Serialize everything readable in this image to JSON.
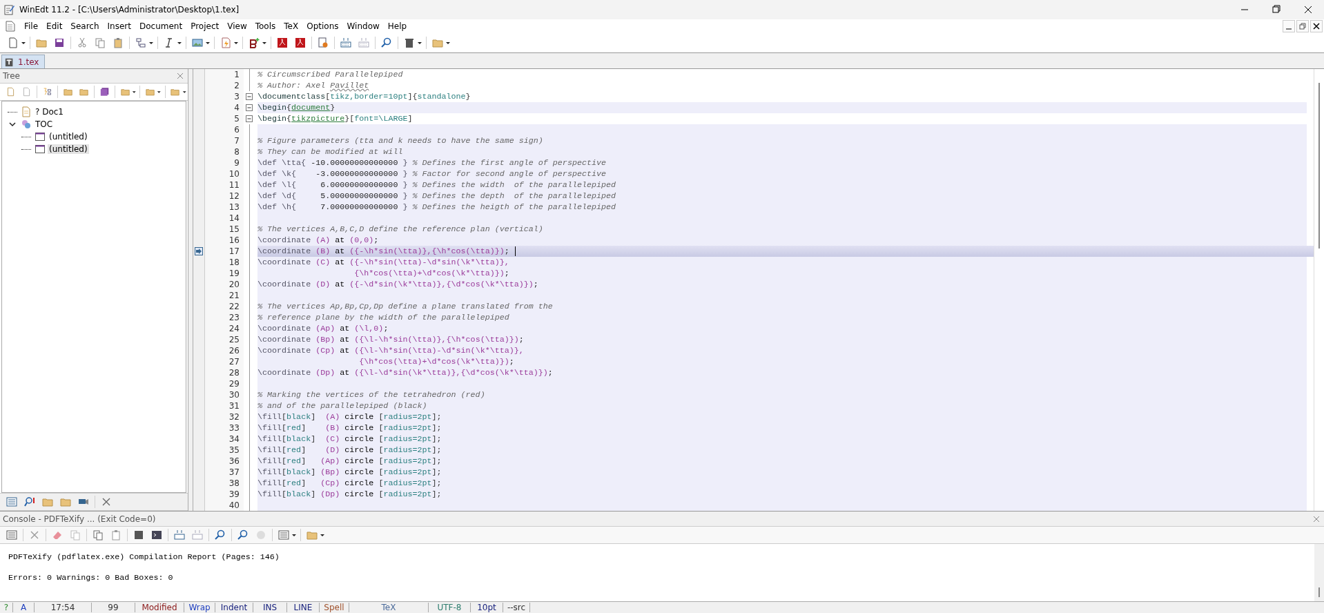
{
  "window": {
    "title": "WinEdt 11.2 - [C:\\Users\\Administrator\\Desktop\\1.tex]"
  },
  "menu": [
    "File",
    "Edit",
    "Search",
    "Insert",
    "Document",
    "Project",
    "View",
    "Tools",
    "TeX",
    "Options",
    "Window",
    "Help"
  ],
  "tabs": [
    {
      "label": "1.tex",
      "selected": true
    }
  ],
  "tree": {
    "title": "Tree",
    "items": [
      {
        "label": "? Doc1",
        "kind": "document",
        "selected": false
      },
      {
        "label": "TOC",
        "kind": "toc",
        "selected": false,
        "expanded": true,
        "children": [
          {
            "label": "(untitled)",
            "kind": "section",
            "selected": false
          },
          {
            "label": "(untitled)",
            "kind": "section",
            "selected": true
          }
        ]
      }
    ]
  },
  "editor": {
    "lines": [
      {
        "n": "1",
        "block": false,
        "current": false,
        "fold": false,
        "bookmark": false,
        "segs": [
          {
            "kind": "comment",
            "text": "% Circumscribed Parallelepiped"
          }
        ]
      },
      {
        "n": "2",
        "block": false,
        "current": false,
        "fold": false,
        "bookmark": false,
        "segs": [
          {
            "kind": "comment",
            "text": "% Author: Axel "
          },
          {
            "kind": "misspelled",
            "text": "Pavillet"
          }
        ]
      },
      {
        "n": "3",
        "block": false,
        "current": false,
        "fold": true,
        "bookmark": false,
        "segs": [
          {
            "kind": "cmd",
            "text": "\\documentclass"
          },
          {
            "kind": "br",
            "text": "["
          },
          {
            "kind": "opt",
            "text": "tikz,border=10pt"
          },
          {
            "kind": "br",
            "text": "]{"
          },
          {
            "kind": "opt",
            "text": "standalone"
          },
          {
            "kind": "br",
            "text": "}"
          }
        ]
      },
      {
        "n": "4",
        "block": true,
        "current": false,
        "fold": true,
        "bookmark": false,
        "segs": [
          {
            "kind": "cmd",
            "text": "\\begin"
          },
          {
            "kind": "br",
            "text": "{"
          },
          {
            "kind": "env",
            "text": "document"
          },
          {
            "kind": "br",
            "text": "}"
          }
        ]
      },
      {
        "n": "5",
        "block": false,
        "current": false,
        "fold": true,
        "bookmark": false,
        "segs": [
          {
            "kind": "cmd",
            "text": "\\begin"
          },
          {
            "kind": "br",
            "text": "{"
          },
          {
            "kind": "env",
            "text": "tikzpicture"
          },
          {
            "kind": "br",
            "text": "}["
          },
          {
            "kind": "opt",
            "text": "font=\\LARGE"
          },
          {
            "kind": "br",
            "text": "]"
          }
        ]
      },
      {
        "n": "6",
        "block": true,
        "current": false,
        "fold": false,
        "bookmark": false
      },
      {
        "n": "7",
        "block": true,
        "current": false,
        "fold": false,
        "bookmark": false,
        "segs": [
          {
            "kind": "comment",
            "text": "% Figure parameters (tta and k needs to have the same sign)"
          }
        ]
      },
      {
        "n": "8",
        "block": true,
        "current": false,
        "fold": false,
        "bookmark": false,
        "segs": [
          {
            "kind": "comment",
            "text": "% They can be modified at will"
          }
        ]
      },
      {
        "n": "9",
        "block": true,
        "current": false,
        "fold": false,
        "bookmark": false,
        "segs": [
          {
            "kind": "macro",
            "text": "\\def \\tta{"
          },
          {
            "kind": "plain",
            "text": " -10.00000000000000 "
          },
          {
            "kind": "macro",
            "text": "}"
          },
          {
            "kind": "comment",
            "text": " % Defines the first angle of perspective"
          }
        ]
      },
      {
        "n": "10",
        "block": true,
        "current": false,
        "fold": false,
        "bookmark": false,
        "segs": [
          {
            "kind": "macro",
            "text": "\\def \\k{"
          },
          {
            "kind": "plain",
            "text": "    -3.00000000000000 "
          },
          {
            "kind": "macro",
            "text": "}"
          },
          {
            "kind": "comment",
            "text": " % Factor for second angle of perspective"
          }
        ]
      },
      {
        "n": "11",
        "block": true,
        "current": false,
        "fold": false,
        "bookmark": false,
        "segs": [
          {
            "kind": "macro",
            "text": "\\def \\l{"
          },
          {
            "kind": "plain",
            "text": "     6.00000000000000 "
          },
          {
            "kind": "macro",
            "text": "}"
          },
          {
            "kind": "comment",
            "text": " % Defines the width  of the parallelepiped"
          }
        ]
      },
      {
        "n": "12",
        "block": true,
        "current": false,
        "fold": false,
        "bookmark": false,
        "segs": [
          {
            "kind": "macro",
            "text": "\\def \\d{"
          },
          {
            "kind": "plain",
            "text": "     5.00000000000000 "
          },
          {
            "kind": "macro",
            "text": "}"
          },
          {
            "kind": "comment",
            "text": " % Defines the depth  of the parallelepiped"
          }
        ]
      },
      {
        "n": "13",
        "block": true,
        "current": false,
        "fold": false,
        "bookmark": false,
        "segs": [
          {
            "kind": "macro",
            "text": "\\def \\h{"
          },
          {
            "kind": "plain",
            "text": "     7.00000000000000 "
          },
          {
            "kind": "macro",
            "text": "}"
          },
          {
            "kind": "comment",
            "text": " % Defines the heigth of the parallelepiped"
          }
        ]
      },
      {
        "n": "14",
        "block": true,
        "current": false,
        "fold": false,
        "bookmark": false
      },
      {
        "n": "15",
        "block": true,
        "current": false,
        "fold": false,
        "bookmark": false,
        "segs": [
          {
            "kind": "comment",
            "text": "% The vertices A,B,C,D define the reference plan (vertical)"
          }
        ]
      },
      {
        "n": "16",
        "block": true,
        "current": false,
        "fold": false,
        "bookmark": false,
        "segs": [
          {
            "kind": "macro",
            "text": "\\coordinate "
          },
          {
            "kind": "math",
            "text": "(A) "
          },
          {
            "kind": "kw",
            "text": "at "
          },
          {
            "kind": "math",
            "text": "(0,0)"
          },
          {
            "kind": "plain",
            "text": ";"
          }
        ]
      },
      {
        "n": "17",
        "block": true,
        "current": true,
        "fold": false,
        "bookmark": true,
        "segs": [
          {
            "kind": "macro",
            "text": "\\coordinate "
          },
          {
            "kind": "math",
            "text": "(B) "
          },
          {
            "kind": "kw",
            "text": "at "
          },
          {
            "kind": "math",
            "text": "({-\\h*sin(\\tta)},{\\h*cos(\\tta)})"
          },
          {
            "kind": "plain",
            "text": ";"
          }
        ]
      },
      {
        "n": "18",
        "block": true,
        "current": false,
        "fold": false,
        "bookmark": false,
        "segs": [
          {
            "kind": "macro",
            "text": "\\coordinate "
          },
          {
            "kind": "math",
            "text": "(C) "
          },
          {
            "kind": "kw",
            "text": "at "
          },
          {
            "kind": "math",
            "text": "({-\\h*sin(\\tta)-\\d*sin(\\k*\\tta)},"
          }
        ]
      },
      {
        "n": "19",
        "block": true,
        "current": false,
        "fold": false,
        "bookmark": false,
        "segs": [
          {
            "kind": "math",
            "text": "                    {\\h*cos(\\tta)+\\d*cos(\\k*\\tta)})"
          },
          {
            "kind": "plain",
            "text": ";"
          }
        ]
      },
      {
        "n": "20",
        "block": true,
        "current": false,
        "fold": false,
        "bookmark": false,
        "segs": [
          {
            "kind": "macro",
            "text": "\\coordinate "
          },
          {
            "kind": "math",
            "text": "(D) "
          },
          {
            "kind": "kw",
            "text": "at "
          },
          {
            "kind": "math",
            "text": "({-\\d*sin(\\k*\\tta)},{\\d*cos(\\k*\\tta)})"
          },
          {
            "kind": "plain",
            "text": ";"
          }
        ]
      },
      {
        "n": "21",
        "block": true,
        "current": false,
        "fold": false,
        "bookmark": false
      },
      {
        "n": "22",
        "block": true,
        "current": false,
        "fold": false,
        "bookmark": false,
        "segs": [
          {
            "kind": "comment",
            "text": "% The vertices Ap,Bp,Cp,Dp define a plane translated from the"
          }
        ]
      },
      {
        "n": "23",
        "block": true,
        "current": false,
        "fold": false,
        "bookmark": false,
        "segs": [
          {
            "kind": "comment",
            "text": "% reference plane by the width of the parallelepiped"
          }
        ]
      },
      {
        "n": "24",
        "block": true,
        "current": false,
        "fold": false,
        "bookmark": false,
        "segs": [
          {
            "kind": "macro",
            "text": "\\coordinate "
          },
          {
            "kind": "math",
            "text": "(Ap) "
          },
          {
            "kind": "kw",
            "text": "at "
          },
          {
            "kind": "math",
            "text": "(\\l,0)"
          },
          {
            "kind": "plain",
            "text": ";"
          }
        ]
      },
      {
        "n": "25",
        "block": true,
        "current": false,
        "fold": false,
        "bookmark": false,
        "segs": [
          {
            "kind": "macro",
            "text": "\\coordinate "
          },
          {
            "kind": "math",
            "text": "(Bp) "
          },
          {
            "kind": "kw",
            "text": "at "
          },
          {
            "kind": "math",
            "text": "({\\l-\\h*sin(\\tta)},{\\h*cos(\\tta)})"
          },
          {
            "kind": "plain",
            "text": ";"
          }
        ]
      },
      {
        "n": "26",
        "block": true,
        "current": false,
        "fold": false,
        "bookmark": false,
        "segs": [
          {
            "kind": "macro",
            "text": "\\coordinate "
          },
          {
            "kind": "math",
            "text": "(Cp) "
          },
          {
            "kind": "kw",
            "text": "at "
          },
          {
            "kind": "math",
            "text": "({\\l-\\h*sin(\\tta)-\\d*sin(\\k*\\tta)},"
          }
        ]
      },
      {
        "n": "27",
        "block": true,
        "current": false,
        "fold": false,
        "bookmark": false,
        "segs": [
          {
            "kind": "math",
            "text": "                     {\\h*cos(\\tta)+\\d*cos(\\k*\\tta)})"
          },
          {
            "kind": "plain",
            "text": ";"
          }
        ]
      },
      {
        "n": "28",
        "block": true,
        "current": false,
        "fold": false,
        "bookmark": false,
        "segs": [
          {
            "kind": "macro",
            "text": "\\coordinate "
          },
          {
            "kind": "math",
            "text": "(Dp) "
          },
          {
            "kind": "kw",
            "text": "at "
          },
          {
            "kind": "math",
            "text": "({\\l-\\d*sin(\\k*\\tta)},{\\d*cos(\\k*\\tta)})"
          },
          {
            "kind": "plain",
            "text": ";"
          }
        ]
      },
      {
        "n": "29",
        "block": true,
        "current": false,
        "fold": false,
        "bookmark": false
      },
      {
        "n": "30",
        "block": true,
        "current": false,
        "fold": false,
        "bookmark": false,
        "segs": [
          {
            "kind": "comment",
            "text": "% Marking the vertices of the tetrahedron (red)"
          }
        ]
      },
      {
        "n": "31",
        "block": true,
        "current": false,
        "fold": false,
        "bookmark": false,
        "segs": [
          {
            "kind": "comment",
            "text": "% and of the parallelepiped (black)"
          }
        ]
      },
      {
        "n": "32",
        "block": true,
        "current": false,
        "fold": false,
        "bookmark": false,
        "segs": [
          {
            "kind": "macro",
            "text": "\\fill"
          },
          {
            "kind": "br",
            "text": "["
          },
          {
            "kind": "opt",
            "text": "black"
          },
          {
            "kind": "br",
            "text": "]  "
          },
          {
            "kind": "math",
            "text": "(A) "
          },
          {
            "kind": "kw",
            "text": "circle "
          },
          {
            "kind": "br",
            "text": "["
          },
          {
            "kind": "opt",
            "text": "radius=2pt"
          },
          {
            "kind": "br",
            "text": "];"
          }
        ]
      },
      {
        "n": "33",
        "block": true,
        "current": false,
        "fold": false,
        "bookmark": false,
        "segs": [
          {
            "kind": "macro",
            "text": "\\fill"
          },
          {
            "kind": "br",
            "text": "["
          },
          {
            "kind": "opt",
            "text": "red"
          },
          {
            "kind": "br",
            "text": "]    "
          },
          {
            "kind": "math",
            "text": "(B) "
          },
          {
            "kind": "kw",
            "text": "circle "
          },
          {
            "kind": "br",
            "text": "["
          },
          {
            "kind": "opt",
            "text": "radius=2pt"
          },
          {
            "kind": "br",
            "text": "];"
          }
        ]
      },
      {
        "n": "34",
        "block": true,
        "current": false,
        "fold": false,
        "bookmark": false,
        "segs": [
          {
            "kind": "macro",
            "text": "\\fill"
          },
          {
            "kind": "br",
            "text": "["
          },
          {
            "kind": "opt",
            "text": "black"
          },
          {
            "kind": "br",
            "text": "]  "
          },
          {
            "kind": "math",
            "text": "(C) "
          },
          {
            "kind": "kw",
            "text": "circle "
          },
          {
            "kind": "br",
            "text": "["
          },
          {
            "kind": "opt",
            "text": "radius=2pt"
          },
          {
            "kind": "br",
            "text": "];"
          }
        ]
      },
      {
        "n": "35",
        "block": true,
        "current": false,
        "fold": false,
        "bookmark": false,
        "segs": [
          {
            "kind": "macro",
            "text": "\\fill"
          },
          {
            "kind": "br",
            "text": "["
          },
          {
            "kind": "opt",
            "text": "red"
          },
          {
            "kind": "br",
            "text": "]    "
          },
          {
            "kind": "math",
            "text": "(D) "
          },
          {
            "kind": "kw",
            "text": "circle "
          },
          {
            "kind": "br",
            "text": "["
          },
          {
            "kind": "opt",
            "text": "radius=2pt"
          },
          {
            "kind": "br",
            "text": "];"
          }
        ]
      },
      {
        "n": "36",
        "block": true,
        "current": false,
        "fold": false,
        "bookmark": false,
        "segs": [
          {
            "kind": "macro",
            "text": "\\fill"
          },
          {
            "kind": "br",
            "text": "["
          },
          {
            "kind": "opt",
            "text": "red"
          },
          {
            "kind": "br",
            "text": "]   "
          },
          {
            "kind": "math",
            "text": "(Ap) "
          },
          {
            "kind": "kw",
            "text": "circle "
          },
          {
            "kind": "br",
            "text": "["
          },
          {
            "kind": "opt",
            "text": "radius=2pt"
          },
          {
            "kind": "br",
            "text": "];"
          }
        ]
      },
      {
        "n": "37",
        "block": true,
        "current": false,
        "fold": false,
        "bookmark": false,
        "segs": [
          {
            "kind": "macro",
            "text": "\\fill"
          },
          {
            "kind": "br",
            "text": "["
          },
          {
            "kind": "opt",
            "text": "black"
          },
          {
            "kind": "br",
            "text": "] "
          },
          {
            "kind": "math",
            "text": "(Bp) "
          },
          {
            "kind": "kw",
            "text": "circle "
          },
          {
            "kind": "br",
            "text": "["
          },
          {
            "kind": "opt",
            "text": "radius=2pt"
          },
          {
            "kind": "br",
            "text": "];"
          }
        ]
      },
      {
        "n": "38",
        "block": true,
        "current": false,
        "fold": false,
        "bookmark": false,
        "segs": [
          {
            "kind": "macro",
            "text": "\\fill"
          },
          {
            "kind": "br",
            "text": "["
          },
          {
            "kind": "opt",
            "text": "red"
          },
          {
            "kind": "br",
            "text": "]   "
          },
          {
            "kind": "math",
            "text": "(Cp) "
          },
          {
            "kind": "kw",
            "text": "circle "
          },
          {
            "kind": "br",
            "text": "["
          },
          {
            "kind": "opt",
            "text": "radius=2pt"
          },
          {
            "kind": "br",
            "text": "];"
          }
        ]
      },
      {
        "n": "39",
        "block": true,
        "current": false,
        "fold": false,
        "bookmark": false,
        "segs": [
          {
            "kind": "macro",
            "text": "\\fill"
          },
          {
            "kind": "br",
            "text": "["
          },
          {
            "kind": "opt",
            "text": "black"
          },
          {
            "kind": "br",
            "text": "] "
          },
          {
            "kind": "math",
            "text": "(Dp) "
          },
          {
            "kind": "kw",
            "text": "circle "
          },
          {
            "kind": "br",
            "text": "["
          },
          {
            "kind": "opt",
            "text": "radius=2pt"
          },
          {
            "kind": "br",
            "text": "];"
          }
        ]
      },
      {
        "n": "40",
        "block": true,
        "current": false,
        "fold": false,
        "bookmark": false
      }
    ]
  },
  "console": {
    "title": "Console - PDFTeXify ... (Exit Code=0)",
    "lines": [
      "PDFTeXify (pdflatex.exe) Compilation Report (Pages: 146)",
      "Errors: 0   Warnings: 0   Bad Boxes: 0"
    ]
  },
  "status_bar": [
    {
      "text": "?",
      "color": "#2e8b2e"
    },
    {
      "text": "A",
      "color": "#1f3fbf"
    },
    {
      "text": "17:54",
      "color": "#333333"
    },
    {
      "text": "99",
      "color": "#333333"
    },
    {
      "text": "Modified",
      "color": "#8b1a1a"
    },
    {
      "text": "Wrap",
      "color": "#1f3fbf"
    },
    {
      "text": "Indent",
      "color": "#1a237e"
    },
    {
      "text": "INS",
      "color": "#1a237e"
    },
    {
      "text": "LINE",
      "color": "#1a237e"
    },
    {
      "text": "Spell",
      "color": "#a0522d"
    },
    {
      "text": "TeX",
      "color": "#4a6a9a"
    },
    {
      "text": "UTF-8",
      "color": "#2e7d6e"
    },
    {
      "text": "10pt",
      "color": "#1a237e"
    },
    {
      "text": "--src",
      "color": "#333333"
    }
  ]
}
